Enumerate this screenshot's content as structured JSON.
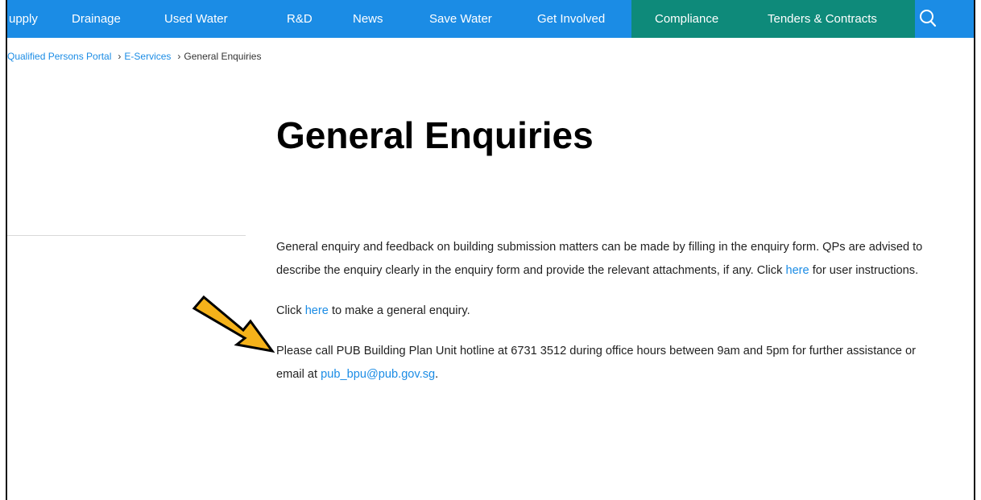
{
  "nav": {
    "items": [
      "upply",
      "Drainage",
      "Used Water",
      "R&D",
      "News",
      "Save Water",
      "Get Involved"
    ],
    "highlighted_items": [
      "Compliance",
      "Tenders & Contracts"
    ],
    "primary_color": "#1b8ce5",
    "highlight_color": "#0e8a7a"
  },
  "breadcrumb": {
    "items": [
      "Qualified Persons Portal",
      "E-Services"
    ],
    "separator": "›",
    "current": "General Enquiries"
  },
  "page": {
    "title": "General Enquiries"
  },
  "content": {
    "p1_text": "General enquiry and feedback on building submission matters can be made by filling in the enquiry form. QPs are advised to describe the enquiry clearly in the enquiry form and provide the relevant attachments, if any. Click ",
    "p1_link": "here",
    "p1_tail": " for user instructions.",
    "p2_prefix": "Click ",
    "p2_link": "here",
    "p2_tail": " to make a general enquiry.",
    "p3_text": "Please call PUB Building Plan Unit hotline at 6731 3512 during office hours between 9am and 5pm for further assistance or email at ",
    "p3_email": "pub_bpu@pub.gov.sg",
    "p3_tail": "."
  },
  "annotation": {
    "arrow_color": "#f5b21a"
  }
}
